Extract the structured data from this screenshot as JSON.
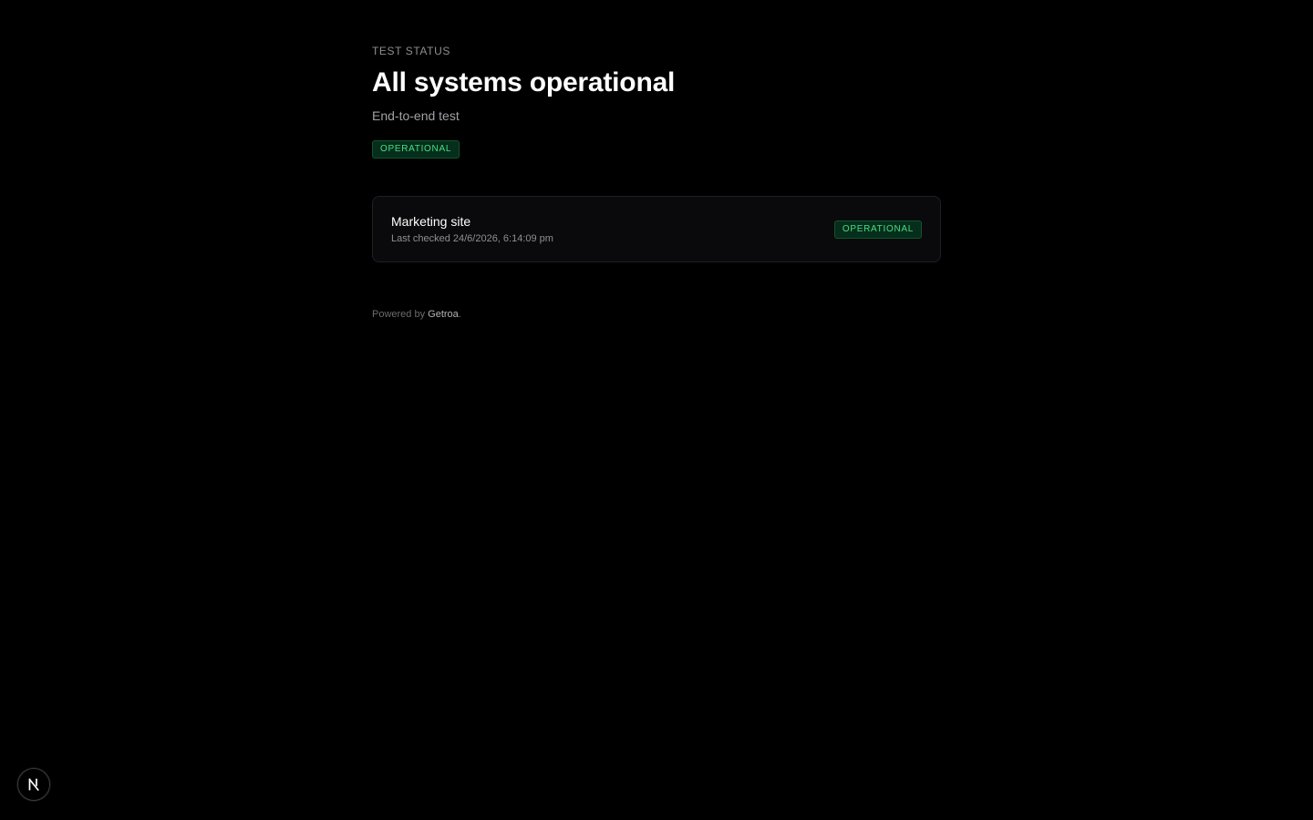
{
  "header": {
    "eyebrow": "TEST STATUS",
    "title": "All systems operational",
    "subtitle": "End-to-end test",
    "overall_status": "OPERATIONAL"
  },
  "components": [
    {
      "name": "Marketing site",
      "last_checked": "Last checked 24/6/2026, 6:14:09 pm",
      "status": "OPERATIONAL"
    }
  ],
  "footer": {
    "prefix": "Powered by",
    "brand": "Getroa",
    "suffix": "."
  },
  "dev_indicator": {
    "icon": "nextjs-logo-icon",
    "letter": "N"
  },
  "colors": {
    "background": "#000000",
    "status_green": "#4ade80",
    "status_bg": "#052e1c"
  }
}
